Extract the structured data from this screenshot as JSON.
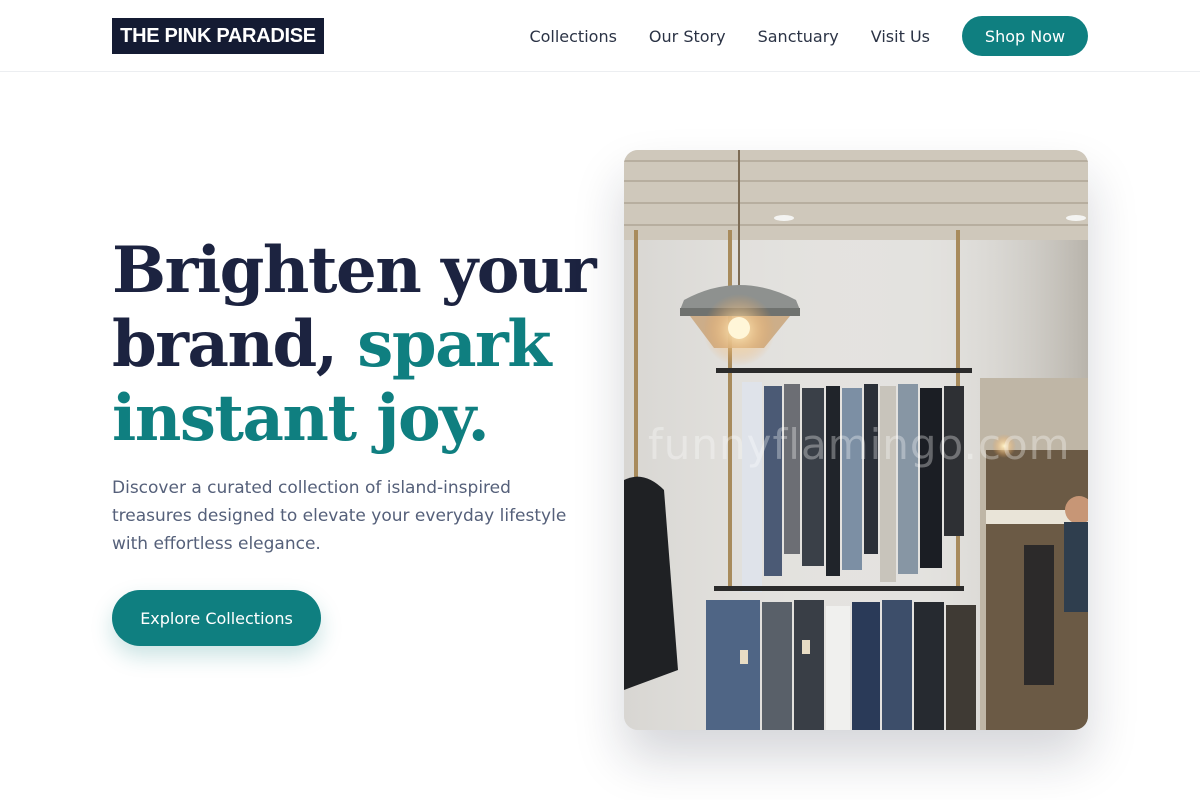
{
  "header": {
    "logo": "THE PINK PARADISE",
    "nav": [
      "Collections",
      "Our Story",
      "Sanctuary",
      "Visit Us"
    ],
    "cta": "Shop Now"
  },
  "hero": {
    "title_line1": "Brighten your",
    "title_line2_plain": "brand,",
    "title_line2_accent": "spark",
    "title_line3_accent": "instant joy.",
    "description": "Discover a curated collection of island-inspired treasures designed to elevate your everyday lifestyle with effortless elegance.",
    "cta": "Explore Collections",
    "image_watermark": "funnyflamingo.com"
  },
  "colors": {
    "brand_dark": "#141b33",
    "accent_teal": "#0f7f80",
    "text_body": "#55607a"
  },
  "icons": {
    "hero_image": "clothing-rack-photo"
  }
}
